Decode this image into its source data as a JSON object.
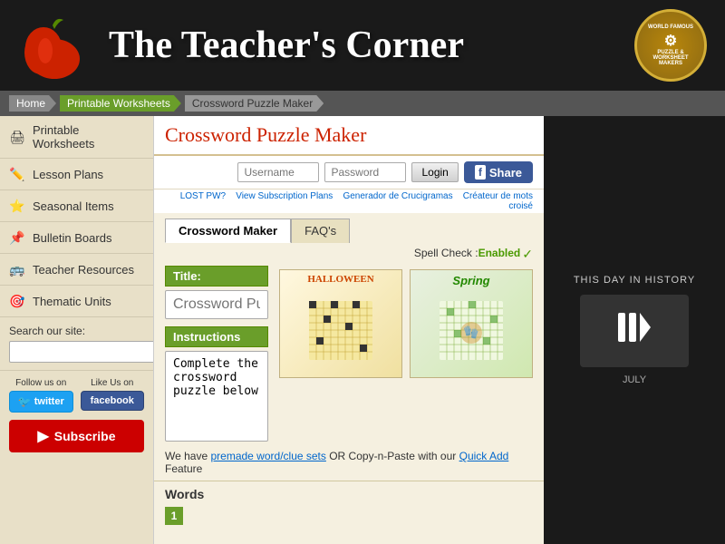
{
  "header": {
    "title": "The Teacher's Corner",
    "badge_line1": "WORLD FAMOUS",
    "badge_line2": "PUZZLE &",
    "badge_line3": "WORKSHEET",
    "badge_line4": "MAKERS"
  },
  "breadcrumb": {
    "items": [
      "Home",
      "Printable Worksheets",
      "Crossword Puzzle Maker"
    ]
  },
  "sidebar": {
    "items": [
      {
        "label": "Printable Worksheets",
        "icon": "🖨"
      },
      {
        "label": "Lesson Plans",
        "icon": "📝"
      },
      {
        "label": "Seasonal Items",
        "icon": "⭐"
      },
      {
        "label": "Bulletin Boards",
        "icon": "📌"
      },
      {
        "label": "Teacher Resources",
        "icon": "📚"
      },
      {
        "label": "Thematic Units",
        "icon": "🎯"
      }
    ],
    "search_label": "Search our site:",
    "search_placeholder": "",
    "follow_label": "Follow us on",
    "like_label": "Like Us on",
    "twitter_label": "twitter",
    "facebook_label": "facebook",
    "subscribe_label": "Subscribe"
  },
  "content": {
    "page_title": "Crossword Puzzle Maker",
    "login": {
      "username_placeholder": "Username",
      "password_placeholder": "Password",
      "login_label": "Login",
      "share_label": "Share",
      "lost_pw_label": "LOST PW?",
      "subscription_label": "View Subscription Plans",
      "generator_label": "Generador de Crucigramas",
      "creator_label": "Créateur de mots croisé"
    },
    "tabs": [
      {
        "label": "Crossword Maker",
        "active": true
      },
      {
        "label": "FAQ's",
        "active": false
      }
    ],
    "spell_check": {
      "label": "Spell Check :",
      "status": "Enabled"
    },
    "form": {
      "title_label": "Title:",
      "title_placeholder": "Crossword Puzzle Title",
      "instructions_label": "Instructions",
      "instructions_value": "Complete the crossword puzzle below"
    },
    "preview": {
      "halloween_title": "HALLOWEEN",
      "spring_title": "Spring"
    },
    "info_text": "We have premade word/clue sets OR Copy-n-Paste with our Quick Add Feature",
    "premade_link": "premade word/clue sets",
    "quick_add_link": "Quick Add",
    "words_title": "Words",
    "word_number": "1"
  },
  "right_panel": {
    "title": "THIS DAY IN HISTORY",
    "date": "JULY"
  }
}
